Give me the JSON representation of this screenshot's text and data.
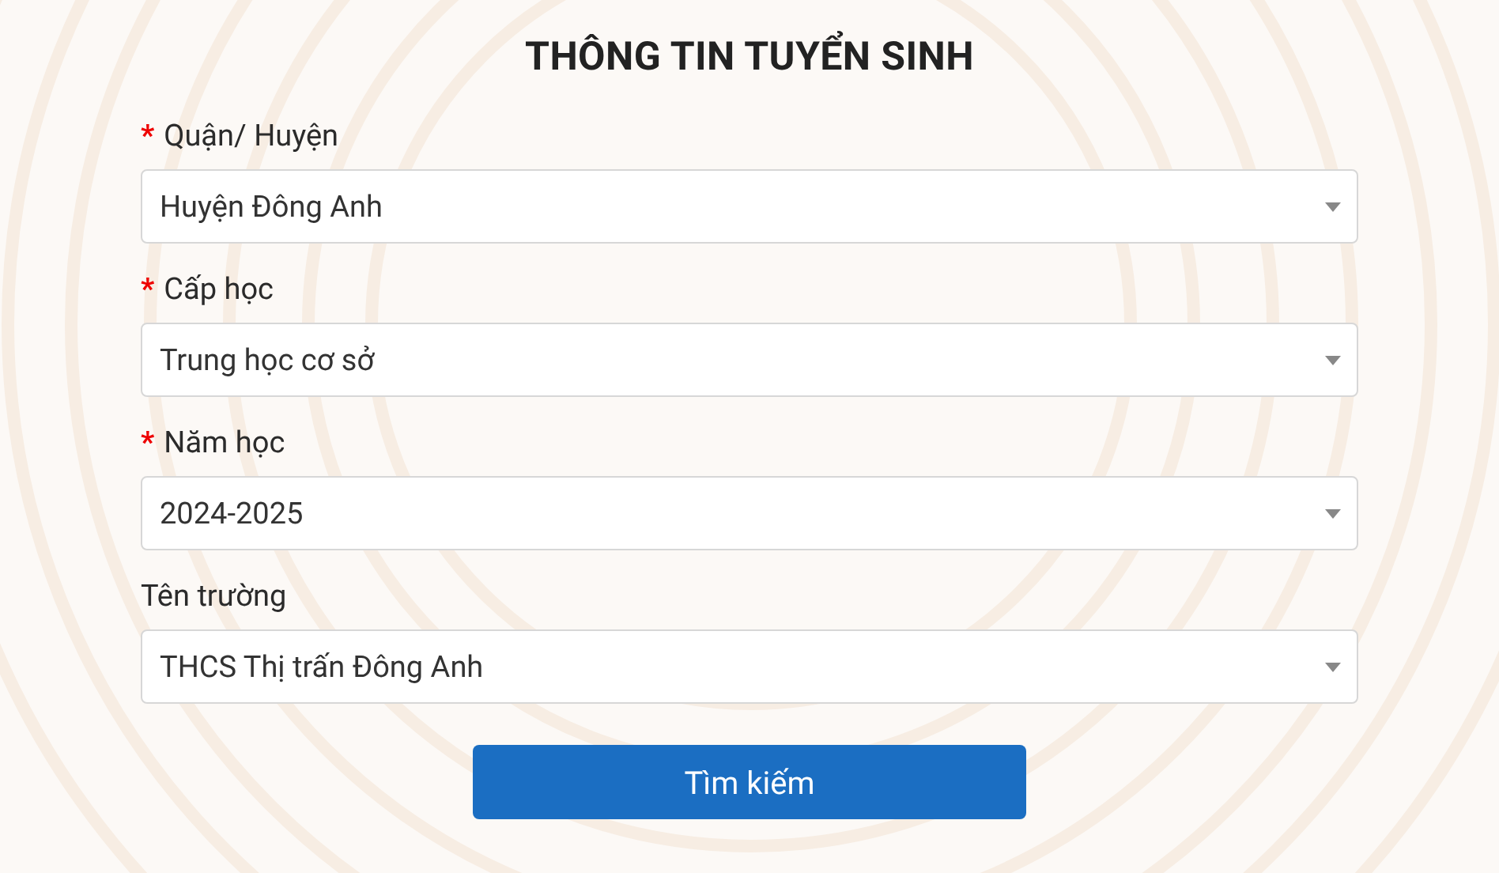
{
  "title": "THÔNG TIN TUYỂN SINH",
  "required_mark": "*",
  "fields": [
    {
      "label": "Quận/ Huyện",
      "required": true,
      "value": "Huyện Đông Anh"
    },
    {
      "label": "Cấp học",
      "required": true,
      "value": "Trung học cơ sở"
    },
    {
      "label": "Năm học",
      "required": true,
      "value": "2024-2025"
    },
    {
      "label": "Tên trường",
      "required": false,
      "value": "THCS Thị trấn Đông Anh"
    }
  ],
  "button": "Tìm kiếm"
}
